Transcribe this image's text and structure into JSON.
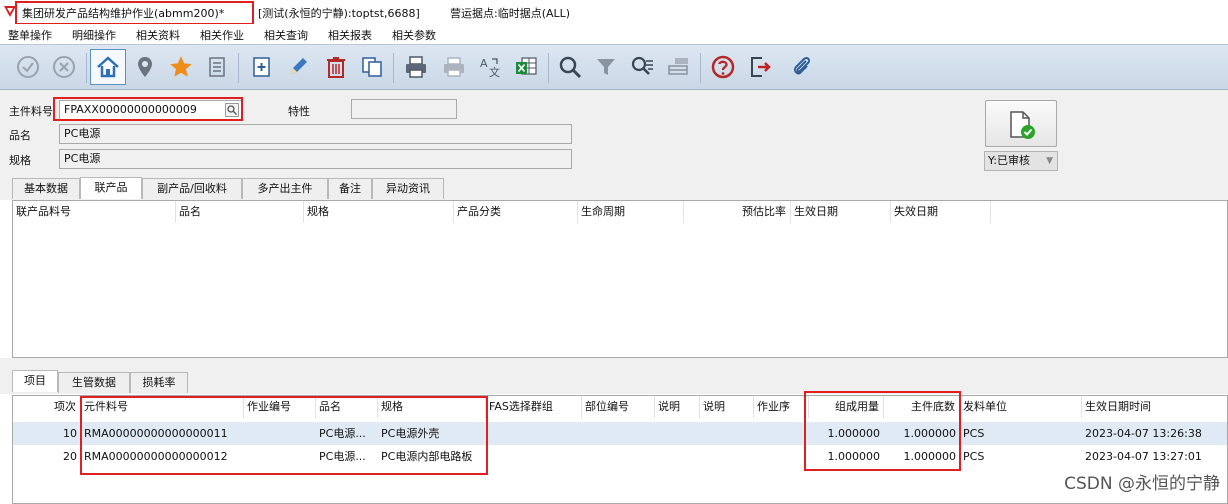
{
  "titlebar": {
    "app_title": "集团研发产品结构维护作业(abmm200)*",
    "env": "[测试(永恒的宁静):toptst,6688]",
    "site": "营运据点:临时据点(ALL)"
  },
  "menubar": {
    "items": [
      "整单操作",
      "明细操作",
      "相关资料",
      "相关作业",
      "相关查询",
      "相关报表",
      "相关参数"
    ]
  },
  "toolbar": {
    "buttons": [
      "confirm-icon",
      "cancel-icon",
      "home-icon",
      "location-pin-icon",
      "star-icon",
      "list-icon",
      "add-icon",
      "edit-pencil-icon",
      "delete-trash-icon",
      "copy-icon",
      "print-icon",
      "print-preview-icon",
      "translate-icon",
      "excel-export-icon",
      "search-icon",
      "filter-icon",
      "advanced-search-icon",
      "tray-icon",
      "help-icon",
      "exit-icon",
      "attachment-clip-icon"
    ]
  },
  "form": {
    "main_item_label": "主件料号",
    "main_item_value": "FPAXX00000000000009",
    "feature_label": "特性",
    "feature_value": "",
    "name_label": "品名",
    "name_value": "PC电源",
    "spec_label": "规格",
    "spec_value": "PC电源",
    "status_value": "Y:已审核"
  },
  "top_tabs": [
    "基本数据",
    "联产品",
    "副产品/回收料",
    "多产出主件",
    "备注",
    "异动资讯"
  ],
  "top_grid": {
    "headers": [
      "联产品料号",
      "品名",
      "规格",
      "产品分类",
      "生命周期",
      "预估比率",
      "生效日期",
      "失效日期"
    ]
  },
  "bottom_tabs": [
    "项目",
    "生管数据",
    "损耗率"
  ],
  "bottom_grid": {
    "headers": [
      "项次",
      "元件料号",
      "作业编号",
      "品名",
      "规格",
      "FAS选择群组",
      "部位编号",
      "说明",
      "说明",
      "作业序",
      "组成用量",
      "主件底数",
      "发料单位",
      "生效日期时间"
    ],
    "rows": [
      [
        "10",
        "RMA00000000000000011",
        "",
        "PC电源...",
        "PC电源外壳",
        "",
        "",
        "",
        "",
        "",
        "1.000000",
        "1.000000",
        "PCS",
        "2023-04-07 13:26:38"
      ],
      [
        "20",
        "RMA00000000000000012",
        "",
        "PC电源...",
        "PC电源内部电路板",
        "",
        "",
        "",
        "",
        "",
        "1.000000",
        "1.000000",
        "PCS",
        "2023-04-07 13:27:01"
      ]
    ]
  },
  "watermark": "CSDN @永恒的宁静",
  "colors": {
    "highlight_red": "#e02020",
    "toolbar_bg": "#c9d7e6",
    "selected_row": "#dfeaf4",
    "confirm_green": "#2aa52a"
  }
}
